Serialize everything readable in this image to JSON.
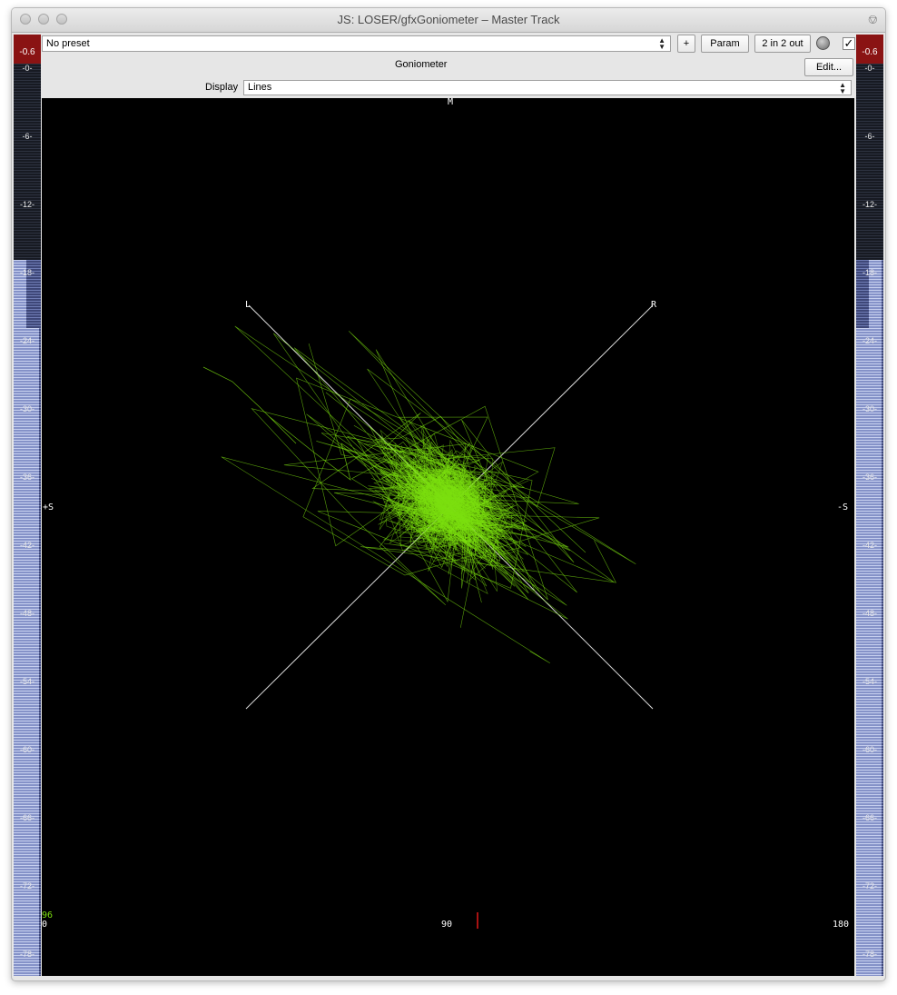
{
  "window": {
    "title": "JS: LOSER/gfxGoniometer – Master Track"
  },
  "toolbar": {
    "preset_value": "No preset",
    "add_label": "+",
    "param_label": "Param",
    "io_label": "2 in 2 out",
    "plugin_name": "Goniometer",
    "edit_label": "Edit...",
    "display_label": "Display",
    "display_value": "Lines",
    "enabled_checked": true
  },
  "meters": {
    "clip_value": "-0.6",
    "ticks": [
      "-0-",
      "-6-",
      "-12-",
      "-18-",
      "-24-",
      "-30-",
      "-36-",
      "-42-",
      "-48-",
      "-54-",
      "-60-",
      "-66-",
      "-72-",
      "-78-"
    ],
    "level_bright_left_db": -24,
    "level_bright_right_db": -24,
    "level_inner_db": -18
  },
  "goniometer": {
    "label_m": "M",
    "label_l": "L",
    "label_r": "R",
    "label_plus_s": "+S",
    "label_minus_s": "-S",
    "counter": "96",
    "scale_min": "0",
    "scale_mid": "90",
    "scale_max": "180",
    "trace_color": "#7ce00f",
    "marker_color": "#e01818"
  }
}
